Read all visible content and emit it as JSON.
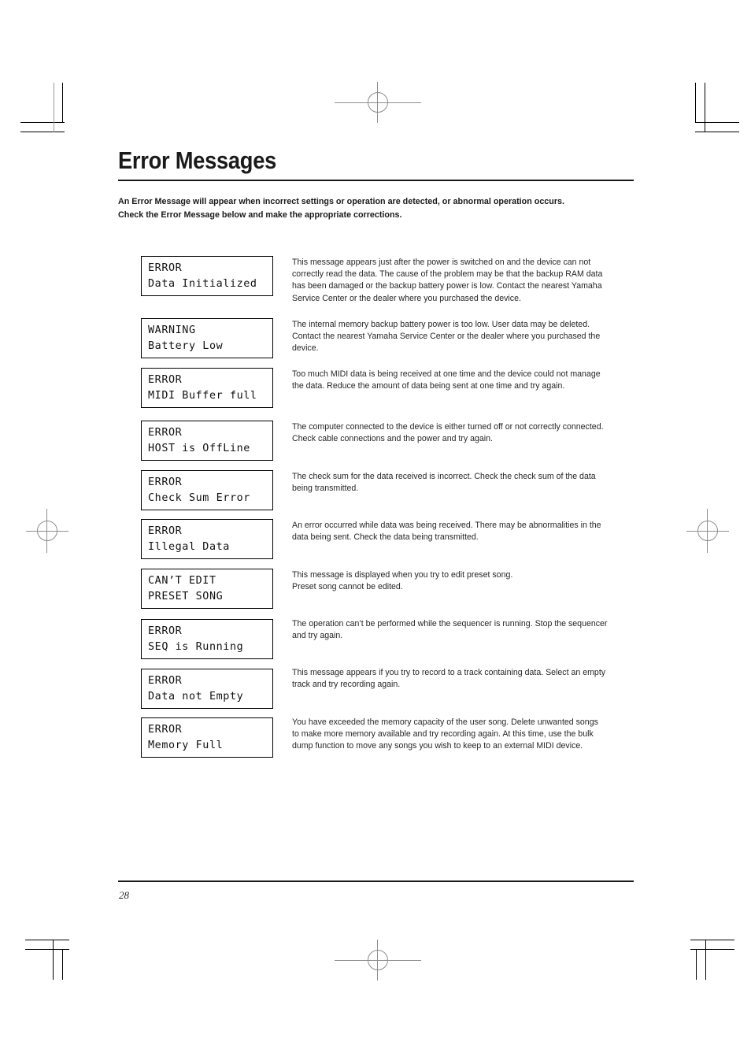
{
  "document": {
    "title": "Error Messages",
    "intro_lines": [
      "An Error Message will appear when incorrect settings or operation are detected, or abnormal operation occurs.",
      "Check the Error Message below and make the appropriate corrections."
    ],
    "page_number": "28"
  },
  "messages": [
    {
      "lcd_line1": "ERROR",
      "lcd_line2": "Data Initialized",
      "description_lines": [
        "This message appears just after the power is switched on and the device can not",
        "correctly read the data. The cause of the problem may be that the backup RAM data",
        "has been damaged or the backup battery power is low. Contact the nearest Yamaha",
        "Service Center or the dealer where you purchased the device."
      ]
    },
    {
      "lcd_line1": "WARNING",
      "lcd_line2": "Battery Low",
      "description_lines": [
        "The internal memory backup battery power is too low. User data may be deleted.",
        "Contact the nearest Yamaha Service Center or the dealer where you purchased the",
        "device."
      ]
    },
    {
      "lcd_line1": "ERROR",
      "lcd_line2": "MIDI Buffer full",
      "description_lines": [
        "Too much MIDI data is being received at one time and the device could not manage",
        "the data. Reduce the amount of data being sent at one time and try again."
      ]
    },
    {
      "lcd_line1": "ERROR",
      "lcd_line2": "HOST is OffLine",
      "description_lines": [
        "The computer connected to the device is either turned off or not correctly connected.",
        "Check cable connections and the power and try again."
      ]
    },
    {
      "lcd_line1": "ERROR",
      "lcd_line2": "Check Sum Error",
      "description_lines": [
        "The check sum for the data received is incorrect. Check the check sum of the data",
        "being transmitted."
      ]
    },
    {
      "lcd_line1": "ERROR",
      "lcd_line2": "Illegal Data",
      "description_lines": [
        "An error occurred while data was being received. There may be abnormalities in the",
        "data being sent. Check the data being transmitted."
      ]
    },
    {
      "lcd_line1": "CAN’T EDIT",
      "lcd_line2": "PRESET SONG",
      "description_lines": [
        "This message is displayed when you try to edit preset song.",
        " Preset song cannot be edited."
      ]
    },
    {
      "lcd_line1": "ERROR",
      "lcd_line2": "SEQ is Running",
      "description_lines": [
        "The operation can’t be performed while the sequencer is running. Stop the sequencer",
        "and try again."
      ]
    },
    {
      "lcd_line1": "ERROR",
      "lcd_line2": "Data not Empty",
      "description_lines": [
        "This message appears if you try to record to a track containing data. Select an empty",
        "track and try recording again."
      ]
    },
    {
      "lcd_line1": "ERROR",
      "lcd_line2": "Memory Full",
      "description_lines": [
        "You have exceeded the memory capacity of the user song. Delete unwanted songs",
        "to make more memory available and try recording again. At this time, use the bulk",
        "dump function to move any songs you wish to keep to an external MIDI device."
      ]
    }
  ],
  "layout": {
    "row_tops": [
      325,
      404,
      467,
      534,
      597,
      659,
      722,
      786,
      849,
      911
    ],
    "desc_tops": [
      326,
      405,
      468,
      535,
      598,
      660,
      723,
      785,
      847,
      910
    ]
  }
}
